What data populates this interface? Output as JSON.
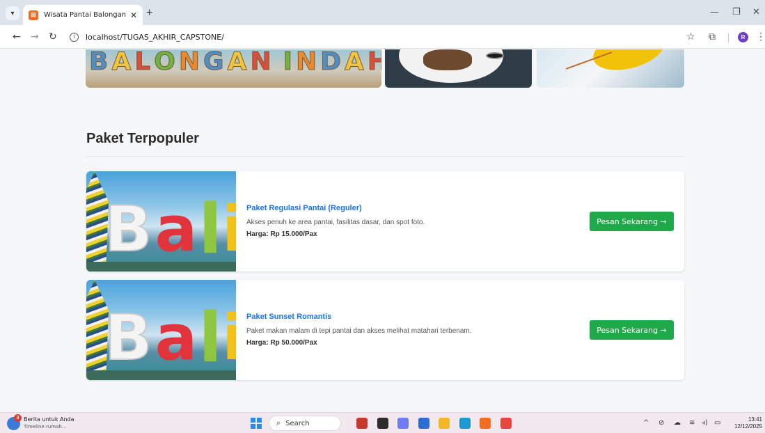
{
  "browser": {
    "tab_title": "Wisata Pantai Balongan Indah",
    "tab_close": "✕",
    "new_tab": "+",
    "url": "localhost/TUGAS_AKHIR_CAPSTONE/",
    "profile_initial": "R",
    "controls": {
      "minimize": "—",
      "restore": "❐",
      "close": "✕"
    }
  },
  "banner": {
    "letters": [
      "B",
      "A",
      "L",
      "O",
      "N",
      "G",
      "A",
      "N",
      "I",
      "N",
      "D",
      "A",
      "H"
    ]
  },
  "section": {
    "title": "Paket Terpopuler"
  },
  "packages": [
    {
      "name": "Paket Regulasi Pantai (Reguler)",
      "description": "Akses penuh ke area pantai, fasilitas dasar, dan spot foto.",
      "price": "Harga: Rp 15.000/Pax",
      "button": "Pesan Sekarang →",
      "image_letters": [
        "B",
        "a",
        "l",
        "i"
      ]
    },
    {
      "name": "Paket Sunset Romantis",
      "description": "Paket makan malam di tepi pantai dan akses melihat matahari terbenam.",
      "price": "Harga: Rp 50.000/Pax",
      "button": "Pesan Sekarang →",
      "image_letters": [
        "B",
        "a",
        "l",
        "i"
      ]
    }
  ],
  "taskbar": {
    "news_badge": "3",
    "news_title": "Berita untuk Anda",
    "news_subtitle": "Timeline rumah...",
    "search_label": "Search",
    "time": "13:41",
    "date": "12/12/2025",
    "apps": [
      {
        "icon": "game-icon",
        "color": "#c8372d"
      },
      {
        "icon": "terminal-icon",
        "color": "#2d2d2d"
      },
      {
        "icon": "copilot-icon",
        "color": "#6e7ef2"
      },
      {
        "icon": "store-icon",
        "color": "#2b6fd6"
      },
      {
        "icon": "folder-icon",
        "color": "#f3b72a"
      },
      {
        "icon": "edge-icon",
        "color": "#1d9bd1"
      },
      {
        "icon": "xampp-icon",
        "color": "#f36d21"
      },
      {
        "icon": "chrome-icon",
        "color": "#e8453c"
      }
    ]
  },
  "colors": {
    "accent_link": "#1a73e8",
    "button_green": "#1faa4a"
  }
}
